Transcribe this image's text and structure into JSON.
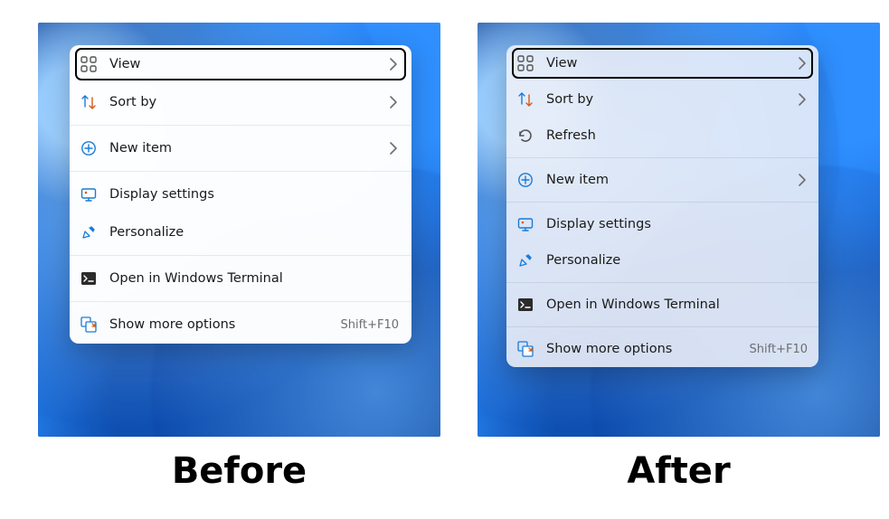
{
  "captions": {
    "before": "Before",
    "after": "After"
  },
  "before_menu": {
    "view": "View",
    "sort": "Sort by",
    "new_item": "New item",
    "display": "Display settings",
    "personalize": "Personalize",
    "terminal": "Open in Windows Terminal",
    "more": "Show more options",
    "more_hint": "Shift+F10"
  },
  "after_menu": {
    "view": "View",
    "sort": "Sort by",
    "refresh": "Refresh",
    "new_item": "New item",
    "display": "Display settings",
    "personalize": "Personalize",
    "terminal": "Open in Windows Terminal",
    "more": "Show more options",
    "more_hint": "Shift+F10"
  }
}
